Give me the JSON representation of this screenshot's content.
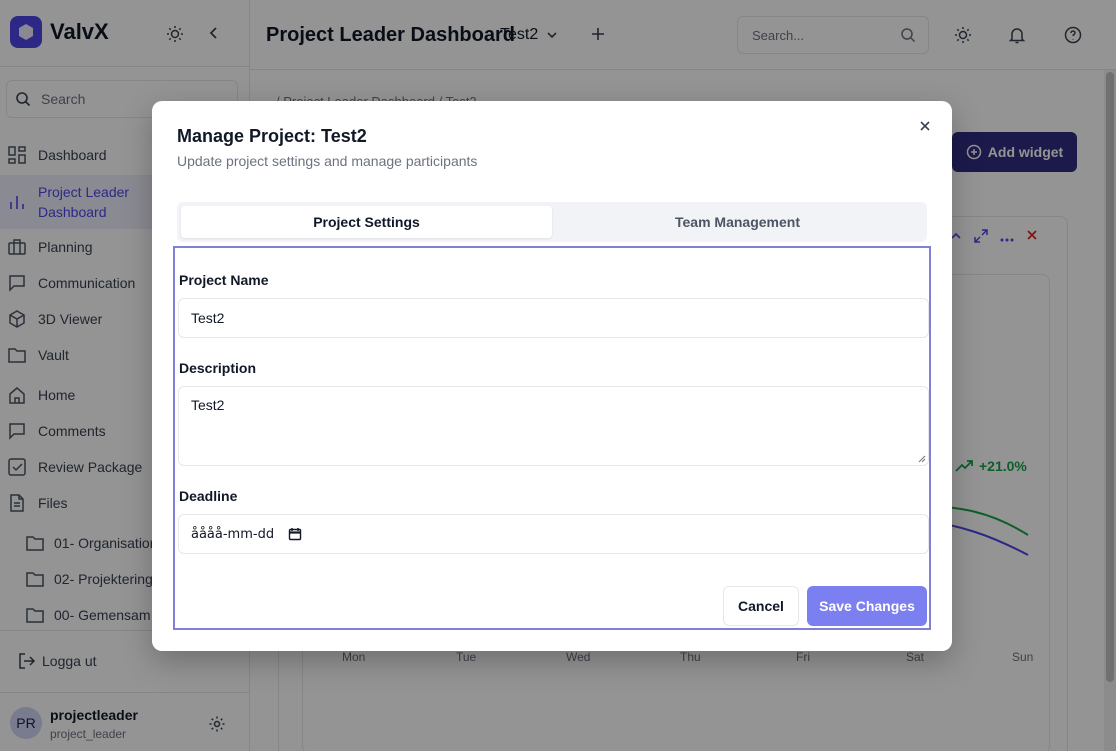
{
  "app": {
    "brand": "ValvX"
  },
  "sidebar": {
    "search_placeholder": "Search",
    "items": [
      {
        "label": "Dashboard",
        "icon": "dashboard-icon"
      },
      {
        "label": "Project Leader Dashboard",
        "icon": "bar-chart-icon",
        "active": true
      },
      {
        "label": "Planning",
        "icon": "briefcase-icon"
      },
      {
        "label": "Communication",
        "icon": "message-icon"
      },
      {
        "label": "3D Viewer",
        "icon": "cube-icon"
      },
      {
        "label": "Vault",
        "icon": "folder-icon"
      },
      {
        "label": "Home",
        "icon": "home-icon"
      },
      {
        "label": "Comments",
        "icon": "comment-icon"
      },
      {
        "label": "Review Package",
        "icon": "checklist-icon"
      },
      {
        "label": "Files",
        "icon": "file-icon"
      }
    ],
    "folders": [
      {
        "label": "01- Organisation",
        "icon": "folder-icon"
      },
      {
        "label": "02- Projektering",
        "icon": "folder-icon"
      },
      {
        "label": "00- Gemensam",
        "icon": "folder-icon"
      }
    ],
    "logout": "Logga ut",
    "user": {
      "initials": "PR",
      "name": "projectleader",
      "username": "project_leader"
    }
  },
  "header": {
    "title": "Project Leader Dashboard",
    "project": "Test2",
    "search_placeholder": "Search..."
  },
  "main": {
    "breadcrumb": "/ Project Leader Dashboard / Test2",
    "add_widget": "Add widget",
    "trend": "+21.0%",
    "days": [
      "Mon",
      "Tue",
      "Wed",
      "Thu",
      "Fri",
      "Sat",
      "Sun"
    ]
  },
  "dialog": {
    "title": "Manage Project: Test2",
    "subtitle": "Update project settings and manage participants",
    "tabs": [
      "Project Settings",
      "Team Management"
    ],
    "active_tab": "Project Settings",
    "fields": {
      "name_label": "Project Name",
      "name_value": "Test2",
      "description_label": "Description",
      "description_value": "Test2",
      "deadline_label": "Deadline",
      "deadline_value": "åååå-mm-dd"
    },
    "cancel": "Cancel",
    "save": "Save Changes"
  },
  "colors": {
    "accent": "#4f46e5",
    "save_button": "#7c7ff0",
    "add_widget_button": "#312e81",
    "trend_up": "#16a34a"
  }
}
